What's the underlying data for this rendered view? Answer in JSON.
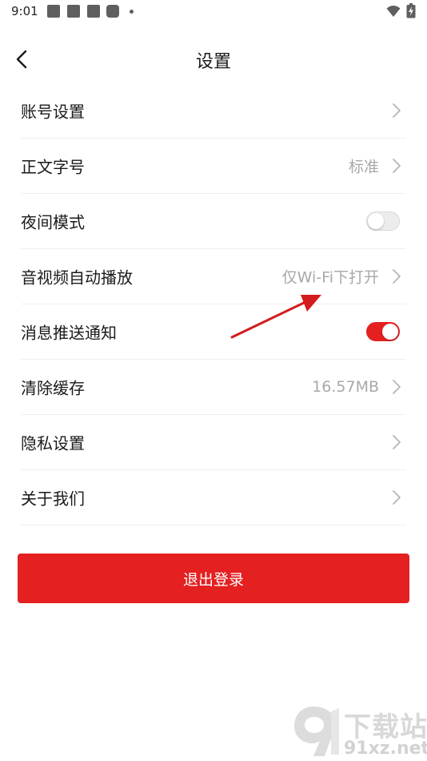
{
  "status_bar": {
    "time": "9:01"
  },
  "header": {
    "title": "设置"
  },
  "settings": [
    {
      "label": "账号设置",
      "value": "",
      "control": "chevron"
    },
    {
      "label": "正文字号",
      "value": "标准",
      "control": "chevron"
    },
    {
      "label": "夜间模式",
      "value": "",
      "control": "toggle",
      "on": false
    },
    {
      "label": "音视频自动播放",
      "value": "仅Wi-Fi下打开",
      "control": "chevron"
    },
    {
      "label": "消息推送通知",
      "value": "",
      "control": "toggle",
      "on": true
    },
    {
      "label": "清除缓存",
      "value": "16.57MB",
      "control": "chevron"
    },
    {
      "label": "隐私设置",
      "value": "",
      "control": "chevron"
    },
    {
      "label": "关于我们",
      "value": "",
      "control": "chevron"
    }
  ],
  "logout": {
    "label": "退出登录"
  },
  "watermark": {
    "brand": "下载站",
    "url": "91xz.net"
  },
  "colors": {
    "accent": "#e42020",
    "text": "#1a1a1a",
    "muted": "#a8a8a8",
    "divider": "#efefef"
  }
}
